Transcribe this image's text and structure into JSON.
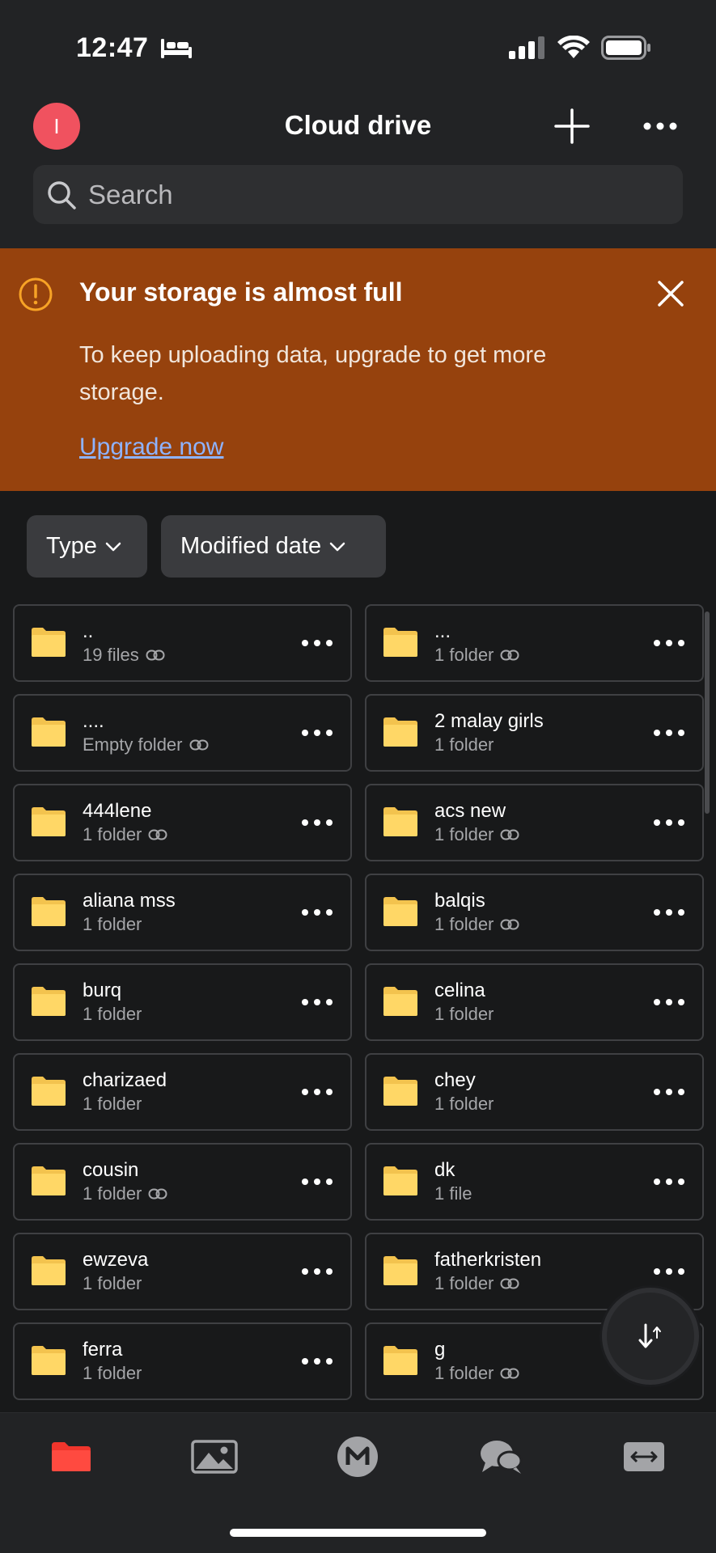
{
  "status": {
    "time": "12:47"
  },
  "header": {
    "avatar_letter": "I",
    "title": "Cloud drive"
  },
  "search": {
    "placeholder": "Search"
  },
  "banner": {
    "title": "Your storage is almost full",
    "message": "To keep uploading data, upgrade to get more storage.",
    "link": "Upgrade now"
  },
  "filters": {
    "type_label": "Type",
    "date_label": "Modified date"
  },
  "items": [
    {
      "name": "..",
      "meta": "19 files",
      "link": true
    },
    {
      "name": "...",
      "meta": "1 folder",
      "link": true
    },
    {
      "name": "....",
      "meta": "Empty folder",
      "link": true
    },
    {
      "name": "2 malay girls",
      "meta": "1 folder",
      "link": false
    },
    {
      "name": "444lene",
      "meta": "1 folder",
      "link": true
    },
    {
      "name": "acs new",
      "meta": "1 folder",
      "link": true
    },
    {
      "name": "aliana mss",
      "meta": "1 folder",
      "link": false
    },
    {
      "name": "balqis",
      "meta": "1 folder",
      "link": true
    },
    {
      "name": "burq",
      "meta": "1 folder",
      "link": false
    },
    {
      "name": "celina",
      "meta": "1 folder",
      "link": false
    },
    {
      "name": "charizaed",
      "meta": "1 folder",
      "link": false
    },
    {
      "name": "chey",
      "meta": "1 folder",
      "link": false
    },
    {
      "name": "cousin",
      "meta": "1 folder",
      "link": true
    },
    {
      "name": "dk",
      "meta": "1 file",
      "link": false
    },
    {
      "name": "ewzeva",
      "meta": "1 folder",
      "link": false
    },
    {
      "name": "fatherkristen",
      "meta": "1 folder",
      "link": true
    },
    {
      "name": "ferra",
      "meta": "1 folder",
      "link": false
    },
    {
      "name": "g",
      "meta": "1 folder",
      "link": true
    }
  ],
  "nav": [
    "folder-icon",
    "photos-icon",
    "mega-icon",
    "chat-icon",
    "transfers-icon"
  ],
  "colors": {
    "accent": "#f0525f",
    "banner": "#96420d",
    "folder": "#ffd766",
    "nav_active": "#f0352c"
  }
}
